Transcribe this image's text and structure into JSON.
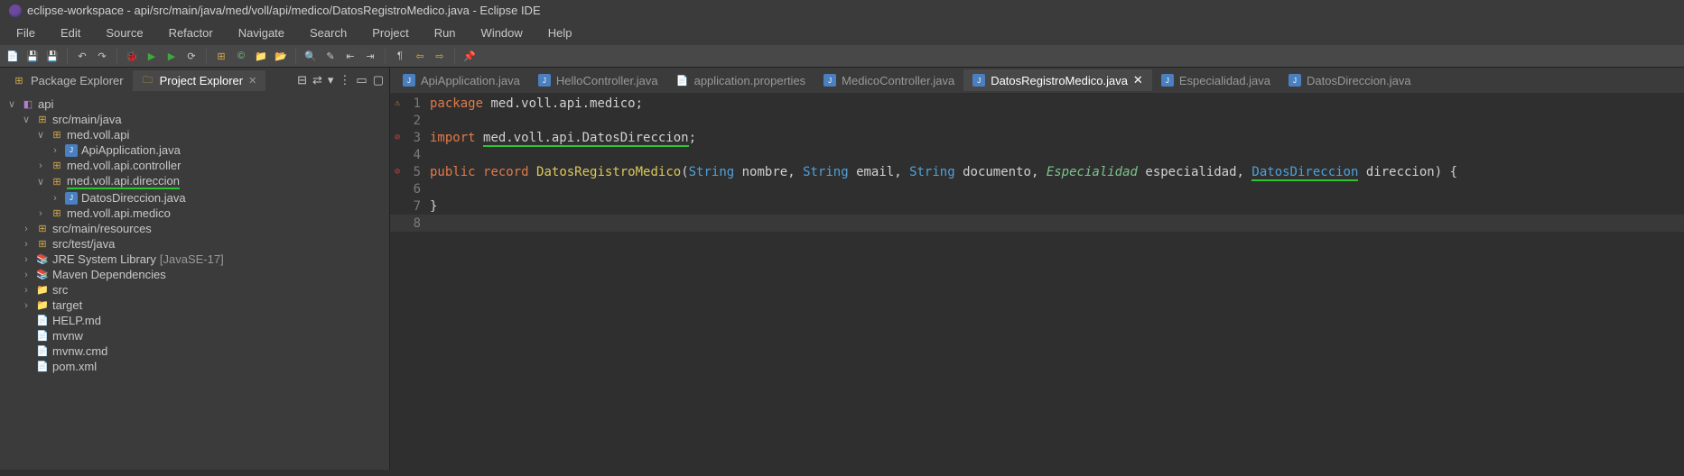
{
  "window": {
    "title": "eclipse-workspace - api/src/main/java/med/voll/api/medico/DatosRegistroMedico.java - Eclipse IDE"
  },
  "menu": {
    "file": "File",
    "edit": "Edit",
    "source": "Source",
    "refactor": "Refactor",
    "navigate": "Navigate",
    "search": "Search",
    "project": "Project",
    "run": "Run",
    "window": "Window",
    "help": "Help"
  },
  "views": {
    "pkg": "Package Explorer",
    "prj": "Project Explorer"
  },
  "tree": {
    "root": "api",
    "src_main_java": "src/main/java",
    "p_api": "med.voll.api",
    "f_apiapp": "ApiApplication.java",
    "p_ctrl": "med.voll.api.controller",
    "p_dir": "med.voll.api.direccion",
    "f_dir": "DatosDireccion.java",
    "p_med": "med.voll.api.medico",
    "src_main_res": "src/main/resources",
    "src_test": "src/test/java",
    "jre": "JRE System Library ",
    "jre_decor": "[JavaSE-17]",
    "maven": "Maven Dependencies",
    "src": "src",
    "target": "target",
    "help": "HELP.md",
    "mvnw": "mvnw",
    "mvnwcmd": "mvnw.cmd",
    "pom": "pom.xml"
  },
  "tabs": {
    "t1": "ApiApplication.java",
    "t2": "HelloController.java",
    "t3": "application.properties",
    "t4": "MedicoController.java",
    "t5": "DatosRegistroMedico.java",
    "t6": "Especialidad.java",
    "t7": "DatosDireccion.java"
  },
  "code": {
    "l1_kw": "package",
    "l1_rest": " med.voll.api.medico;",
    "l3_kw": "import",
    "l3_p1": " ",
    "l3_p2": "med.voll.api.DatosDireccion",
    "l3_p3": ";",
    "l5_public": "public",
    "l5_record": "record",
    "l5_class": "DatosRegistroMedico",
    "l5_string": "String",
    "l5_nombre": " nombre, ",
    "l5_email": " email, ",
    "l5_doc": " documento, ",
    "l5_espT": "Especialidad",
    "l5_esp": " especialidad, ",
    "l5_dirT": "DatosDireccion",
    "l5_dir": " direccion) {",
    "l7": "}"
  },
  "ln": {
    "1": "1",
    "2": "2",
    "3": "3",
    "4": "4",
    "5": "5",
    "6": "6",
    "7": "7",
    "8": "8"
  }
}
